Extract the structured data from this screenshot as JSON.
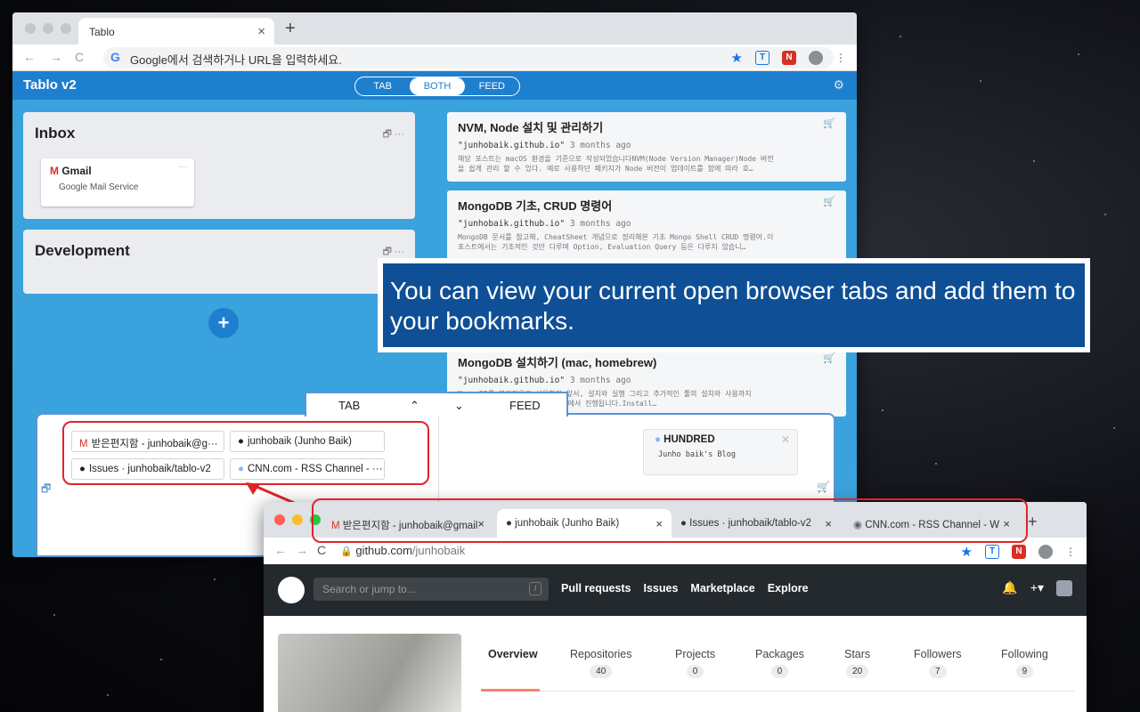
{
  "browser": {
    "tab_title": "Tablo",
    "omnibox_placeholder": "Google에서 검색하거나 URL을 입력하세요."
  },
  "app": {
    "title": "Tablo v2",
    "switch": [
      "TAB",
      "BOTH",
      "FEED"
    ]
  },
  "boards": [
    {
      "title": "Inbox",
      "cards": [
        {
          "title": "Gmail",
          "subtitle": "Google Mail Service"
        }
      ]
    },
    {
      "title": "Development",
      "cards": []
    }
  ],
  "feed": [
    {
      "title": "NVM, Node 설치 및 관리하기",
      "source": "\"junhobaik.github.io\"",
      "time": "3 months ago",
      "desc1": "해당 포스트는 macOS 환경을 기준으로 작성되었습니다NVM(Node Version Manager)Node 버전",
      "desc2": "을 쉽게 관리 할 수 있다. 예로 사용하던 패키지가 Node 버전이 업데이트를 함에 따라 호…"
    },
    {
      "title": "MongoDB 기초, CRUD 명령어",
      "source": "\"junhobaik.github.io\"",
      "time": "3 months ago",
      "desc1": "MongoDB 문서를 참고해, CheatSheet 개념으로 정리해본 기초 Mongo Shell CRUD 명령어.이",
      "desc2": "포스트에서는 기초적인 것만 다루며 Option, Evaluation Query 등은 다루지 않습니…"
    },
    {
      "title": "MongoDB 설치하기 (mac, homebrew)",
      "source": "\"junhobaik.github.io\"",
      "time": "3 months ago",
      "desc1": "MongoDB를 본격적으로 사용하기 앞서, 설치와 실행 그리고 추가적인 툴의 설치와 사용까지",
      "desc2": "macOS / HomeBrew의 설치 환경에서 진행됩니다.Install…"
    }
  ],
  "tooltip": "You can view your current open browser tabs and add them to your bookmarks.",
  "drawer": {
    "tab_label": "TAB",
    "feed_label": "FEED",
    "open_tabs": [
      "받은편지함 - junhobaik@g···",
      "junhobaik (Junho Baik)",
      "Issues · junhobaik/tablo-v2",
      "CNN.com - RSS Channel - ···"
    ],
    "feed_site": {
      "title": "HUNDRED",
      "subtitle": "Junho baik's Blog"
    }
  },
  "github_window": {
    "tabs": [
      "받은편지함 - junhobaik@gmail",
      "junhobaik (Junho Baik)",
      "Issues · junhobaik/tablo-v2",
      "CNN.com - RSS Channel - W"
    ],
    "url_host": "github.com",
    "url_path": "/junhobaik",
    "search_placeholder": "Search or jump to...",
    "nav": [
      "Pull requests",
      "Issues",
      "Marketplace",
      "Explore"
    ],
    "profile_tabs": [
      {
        "label": "Overview",
        "count": ""
      },
      {
        "label": "Repositories",
        "count": "40"
      },
      {
        "label": "Projects",
        "count": "0"
      },
      {
        "label": "Packages",
        "count": "0"
      },
      {
        "label": "Stars",
        "count": "20"
      },
      {
        "label": "Followers",
        "count": "7"
      },
      {
        "label": "Following",
        "count": "9"
      }
    ]
  },
  "colors": {
    "accent": "#1e7fcf",
    "highlight": "#e0242a",
    "tooltip_bg": "#0e4f96"
  }
}
